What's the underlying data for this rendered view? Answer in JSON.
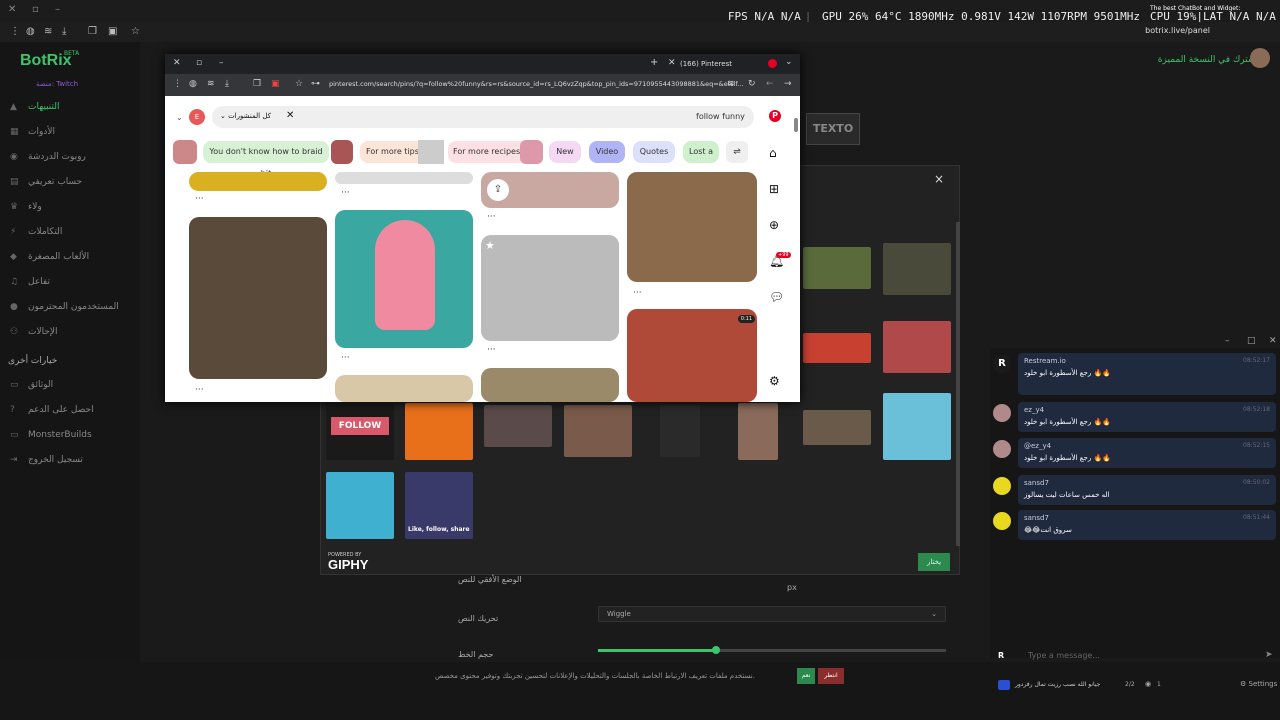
{
  "os": {
    "hud": {
      "fps_label": "FPS",
      "fps": "N/A",
      "fps2": "N/A",
      "gpu_label": "GPU",
      "gpu_pct": "26",
      "pct_unit": "%",
      "gpu_temp": "64",
      "temp_unit": "°C",
      "gpu_clk": "1890",
      "clk_unit": "MHz",
      "gpu_volt": "0.981",
      "volt_unit": "V",
      "gpu_watt": "142",
      "watt_unit": "W",
      "gpu_fan": "1107",
      "fan_unit": "RPM",
      "mem_clk": "9501",
      "cpu_label": "CPU",
      "cpu_pct": "19",
      "cpu_unit": "%",
      "lat_label": "LAT",
      "lat1": "N/A",
      "lat2": "N/A"
    },
    "window_title": "The best ChatBot and Widget:",
    "url": "botrix.live/panel"
  },
  "sidebar": {
    "logo": "BotRix",
    "beta": "BETA",
    "subtitle": "منصة: Twitch",
    "items": [
      {
        "label": "التنبيهات",
        "icon": "triangle-icon"
      },
      {
        "label": "الأدوات",
        "icon": "grid-icon"
      },
      {
        "label": "روبوت الدردشة",
        "icon": "bot-icon"
      },
      {
        "label": "حساب تعريفي",
        "icon": "card-icon"
      },
      {
        "label": "ولاء",
        "icon": "trophy-icon"
      },
      {
        "label": "التكاملات",
        "icon": "plug-icon"
      },
      {
        "label": "الألعاب المصغرة",
        "icon": "game-icon"
      },
      {
        "label": "تفاعل",
        "icon": "music-icon"
      },
      {
        "label": "المستخدمون المحترمون",
        "icon": "users-icon"
      },
      {
        "label": "الإحالات",
        "icon": "people-icon"
      }
    ],
    "section": "خيارات أخرى",
    "items2": [
      {
        "label": "الوثائق",
        "icon": "doc-icon"
      },
      {
        "label": "احصل على الدعم",
        "icon": "help-icon"
      },
      {
        "label": "MonsterBuilds",
        "icon": "monitor-icon"
      },
      {
        "label": "تسجيل الخروج",
        "icon": "logout-icon"
      }
    ]
  },
  "header": {
    "promo": "اشترك في النسخة المميزة"
  },
  "texto_label": "TEXTO",
  "modal": {
    "powered": "POWERED BY",
    "giphy": "GIPHY",
    "pick": "يختار",
    "follow_tile": "FOLLOW",
    "share_tile": "Like, follow, share",
    "close": "×"
  },
  "settings": {
    "pos_label": "الوضع الأفقي للنص",
    "unit": "px",
    "anim_label": "تحريك النص",
    "anim_value": "Wiggle",
    "size_label": "حجم الخط"
  },
  "cookie": {
    "text": "نستخدم ملفات تعريف الارتباط الخاصة بالجلسات والتحليلات والإعلانات لتحسين تجربتك وتوفير محتوى مخصص.",
    "ok": "نعم",
    "no": "انتظر"
  },
  "chat": {
    "messages": [
      {
        "name": "Restream.io",
        "time": "08:52:17",
        "body": "رجع الأسطورة ابو خلود 🔥🔥"
      },
      {
        "name": "ez_y4",
        "time": "08:52:18",
        "body": "رجع الأسطورة ابو خلود 🔥🔥"
      },
      {
        "name": "@ez_y4",
        "time": "08:52:15",
        "body": "رجع الأسطورة ابو خلود 🔥🔥"
      },
      {
        "name": "sansd7",
        "time": "08:50:02",
        "body": "اله خمس ساعات ليت يسالوز"
      },
      {
        "name": "sansd7",
        "time": "08:51:44",
        "body": "😂😂سروق انت"
      }
    ],
    "placeholder": "Type a message...",
    "footer_user": "جيانو الله نصب رزيت تمال رقردور",
    "pages": "2/2",
    "viewers": "1",
    "settings": "Settings"
  },
  "pinterest": {
    "tab": "(166) Pinterest",
    "url": "pinterest.com/search/pins/?q=follow%20funny&rs=rs&source_id=rs_LQ6vzZqp&top_pin_ids=9710955443098881&eq=&etslf...",
    "filter": "كل المنشورات",
    "query": "follow funny",
    "avatar_letter": "E",
    "chips": [
      "You don't know how to braid hit",
      "For more tips",
      "For more recipes",
      "New",
      "Video",
      "Quotes",
      "Lost a"
    ],
    "badge": "+99",
    "video_time": "0:11",
    "notif_count": "22"
  }
}
